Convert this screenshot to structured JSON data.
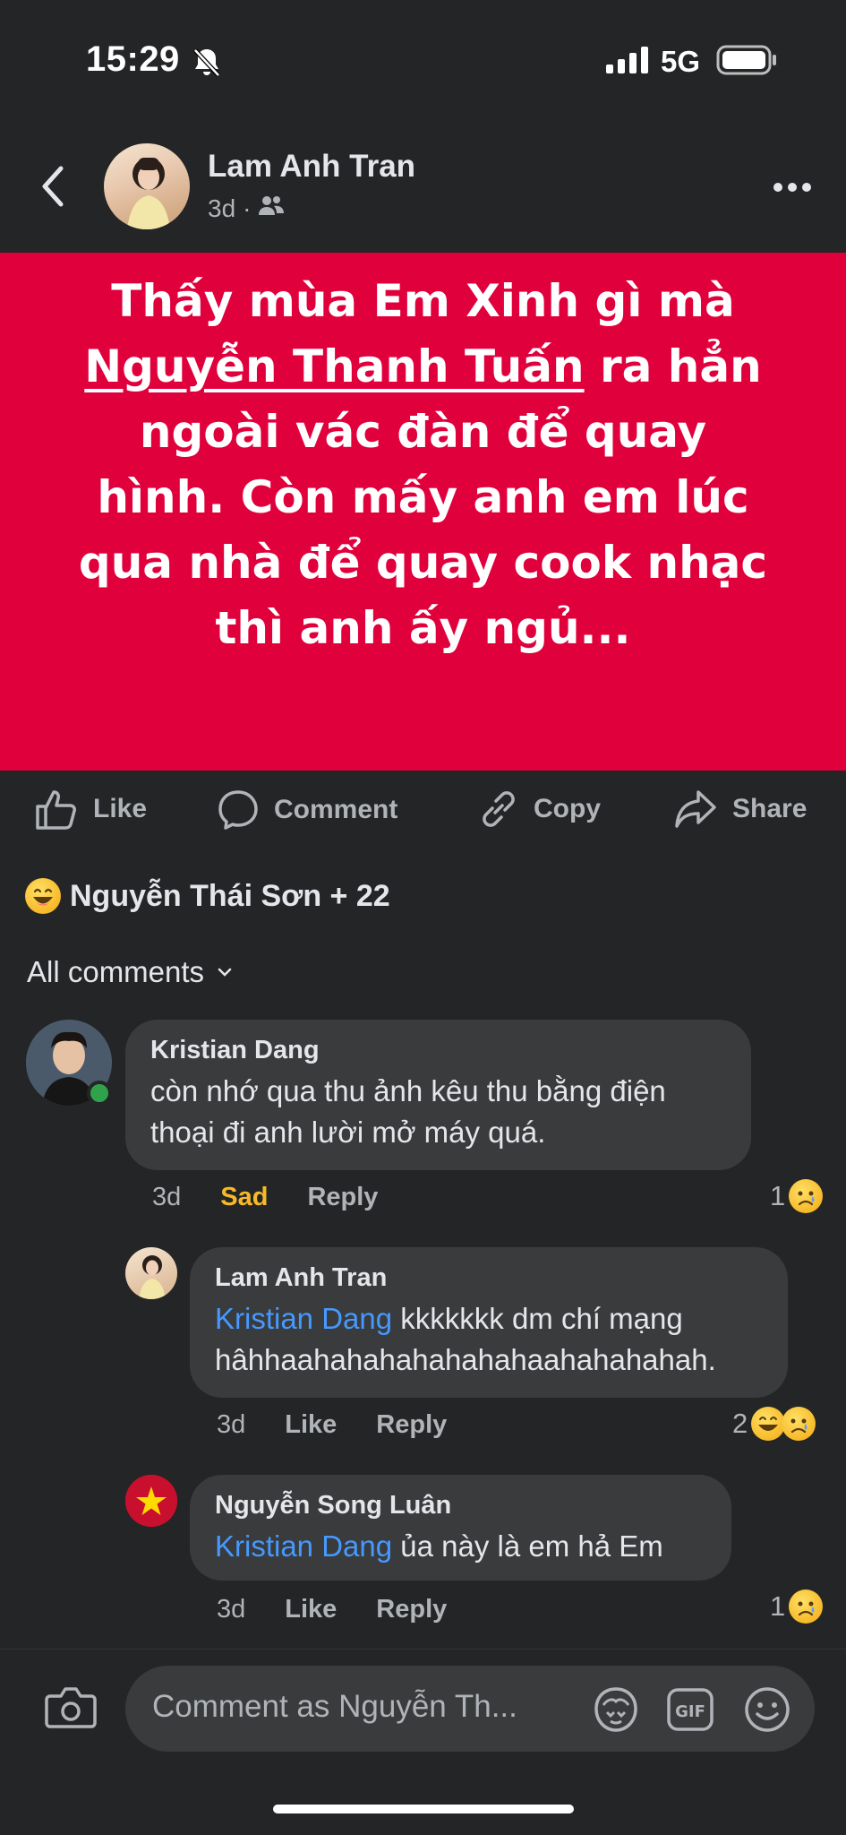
{
  "status_bar": {
    "time": "15:29",
    "network": "5G"
  },
  "header": {
    "name": "Lam Anh Tran",
    "time": "3d",
    "separator": "·"
  },
  "post": {
    "line1": "Thấy mùa Em Xinh gì mà",
    "mention": "Nguyễn Thanh Tuấn",
    "line2_rest": " ra hẳn",
    "line3": "ngoài vác đàn để quay",
    "line4": "hình. Còn mấy anh em lúc",
    "line5": "qua nhà để quay cook nhạc",
    "line6": "thì anh ấy ngủ...",
    "background_color": "#e0003c"
  },
  "actions": {
    "like": "Like",
    "comment": "Comment",
    "copy": "Copy",
    "share": "Share"
  },
  "reactions_summary": {
    "text": "Nguyễn Thái Sơn + 22"
  },
  "filter": {
    "label": "All comments"
  },
  "comments": [
    {
      "name": "Kristian Dang",
      "text": "còn nhớ qua thu ảnh kêu thu bằng điện thoại đi anh lười mở máy quá.",
      "time": "3d",
      "reaction_label": "Sad",
      "reply": "Reply",
      "count": "1"
    },
    {
      "name": "Lam Anh Tran",
      "mention": "Kristian Dang",
      "text": " kkkkkkk dm chí mạng hâhhaahahahahahahahaahahahahah.",
      "time": "3d",
      "like": "Like",
      "reply": "Reply",
      "count": "2"
    },
    {
      "name": "Nguyễn Song Luân",
      "mention": "Kristian Dang",
      "text": " ủa này là em hả Em",
      "time": "3d",
      "like": "Like",
      "reply": "Reply",
      "count": "1"
    }
  ],
  "composer": {
    "placeholder": "Comment as Nguyễn Th..."
  },
  "colors": {
    "accent": "#4599ff",
    "sad_label": "#f7b928",
    "background": "#242526"
  }
}
